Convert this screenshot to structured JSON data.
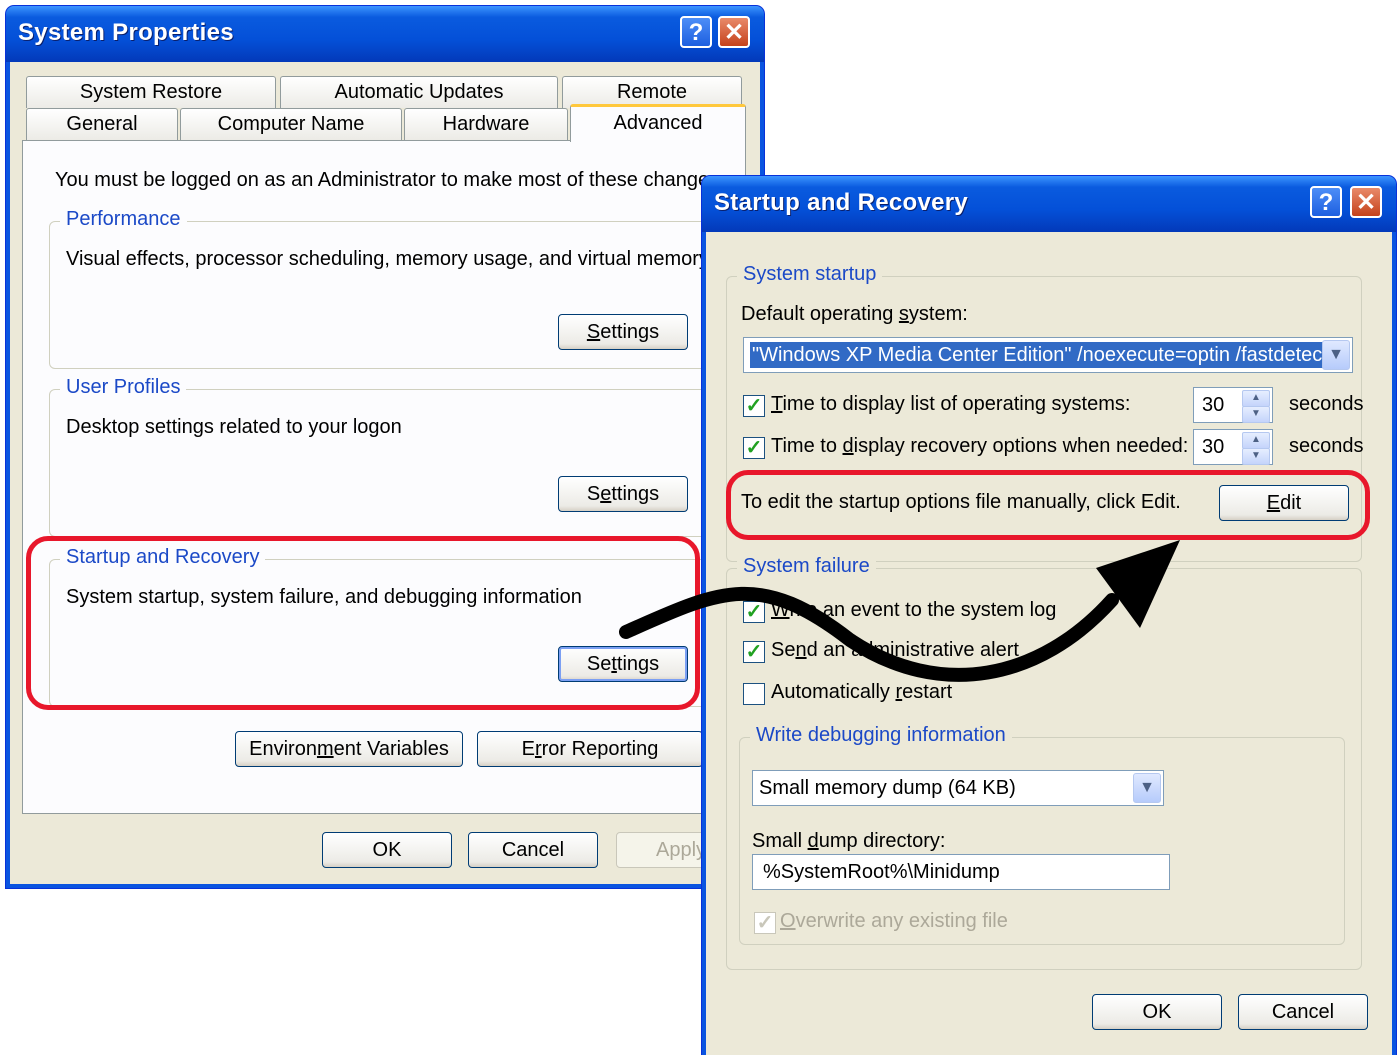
{
  "sys": {
    "title": "System Properties",
    "help": "?",
    "close": "✕",
    "tabs_top": [
      "System Restore",
      "Automatic Updates",
      "Remote"
    ],
    "tabs_bottom": [
      "General",
      "Computer Name",
      "Hardware",
      "Advanced"
    ],
    "notice": "You must be logged on as an Administrator to make most of these changes.",
    "perf": {
      "label": "Performance",
      "desc": "Visual effects, processor scheduling, memory usage, and virtual memory",
      "btn": "Settings"
    },
    "profiles": {
      "label": "User Profiles",
      "desc": "Desktop settings related to your logon",
      "btn": "Settings"
    },
    "startup": {
      "label": "Startup and Recovery",
      "desc": "System startup, system failure, and debugging information",
      "btn": "Settings"
    },
    "env_btn": "Environment Variables",
    "err_btn": "Error Reporting",
    "ok": "OK",
    "cancel": "Cancel",
    "apply": "Apply"
  },
  "sr": {
    "title": "Startup and Recovery",
    "help": "?",
    "close": "✕",
    "startup_group": "System startup",
    "default_os_label": "Default operating system:",
    "default_os_value": "\"Windows XP Media Center Edition\" /noexecute=optin /fastdetect",
    "time_list_label": "Time to display list of operating systems:",
    "time_list_value": "30",
    "time_recovery_label": "Time to display recovery options when needed:",
    "time_recovery_value": "30",
    "seconds": "seconds",
    "edit_text": "To edit the startup options file manually, click Edit.",
    "edit_btn": "Edit",
    "failure_group": "System failure",
    "write_event": "Write an event to the system log",
    "send_alert": "Send an administrative alert",
    "auto_restart": "Automatically restart",
    "debug_group": "Write debugging information",
    "dump_value": "Small memory dump (64 KB)",
    "dump_dir_label": "Small dump directory:",
    "dump_dir_value": "%SystemRoot%\\Minidump",
    "overwrite": "Overwrite any existing file",
    "ok": "OK",
    "cancel": "Cancel"
  },
  "checks": {
    "time_list": true,
    "time_recovery": true,
    "write_event": true,
    "send_alert": true,
    "auto_restart": false,
    "overwrite": true
  },
  "colors": {
    "highlight": "#e8172b",
    "title_blue": "#0a54e0",
    "group_label": "#1b49c7"
  }
}
